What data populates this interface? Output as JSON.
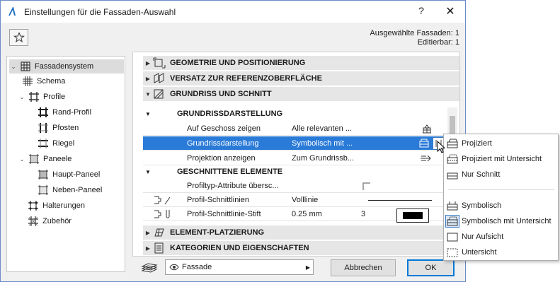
{
  "window": {
    "title": "Einstellungen für die Fassaden-Auswahl",
    "help_label": "?",
    "close_label": "✕"
  },
  "info": {
    "selected": "Ausgewählte Fassaden: 1",
    "editable": "Editierbar: 1"
  },
  "tree": {
    "items": [
      {
        "label": "Fassadensystem",
        "expanded": true,
        "selected": true
      },
      {
        "label": "Schema"
      },
      {
        "label": "Profile",
        "expanded": true
      },
      {
        "label": "Rand-Profil"
      },
      {
        "label": "Pfosten"
      },
      {
        "label": "Riegel"
      },
      {
        "label": "Paneele",
        "expanded": true
      },
      {
        "label": "Haupt-Paneel"
      },
      {
        "label": "Neben-Paneel"
      },
      {
        "label": "Halterungen"
      },
      {
        "label": "Zubehör"
      }
    ]
  },
  "sections": {
    "geometry": "GEOMETRIE UND POSITIONIERUNG",
    "offset": "VERSATZ ZUR REFERENZOBERFLÄCHE",
    "plan": "GRUNDRISS UND SCHNITT",
    "placement": "ELEMENT-PLATZIERUNG",
    "categories": "KATEGORIEN UND EIGENSCHAFTEN"
  },
  "plan": {
    "sub1": "GRUNDRISSDARSTELLUNG",
    "sub2": "GESCHNITTENE ELEMENTE",
    "rows": [
      {
        "label": "Auf Geschoss zeigen",
        "value": "Alle relevanten ..."
      },
      {
        "label": "Grundrissdarstellung",
        "value": "Symbolisch mit ..."
      },
      {
        "label": "Projektion anzeigen",
        "value": "Zum Grundrissb..."
      },
      {
        "label": "Profiltyp-Attribute übersc..."
      },
      {
        "label": "Profil-Schnittlinien",
        "value": "Volllinie"
      },
      {
        "label": "Profil-Schnittlinie-Stift",
        "value": "0.25 mm",
        "num": "3"
      }
    ]
  },
  "footer": {
    "view_select": "Fassade",
    "cancel": "Abbrechen",
    "ok": "OK"
  },
  "popup": {
    "items": [
      {
        "label": "Projiziert"
      },
      {
        "label": "Projiziert mit Untersicht"
      },
      {
        "label": "Nur Schnitt"
      },
      {
        "label": "Symbolisch"
      },
      {
        "label": "Symbolisch mit Untersicht",
        "checked": true
      },
      {
        "label": "Nur Aufsicht"
      },
      {
        "label": "Untersicht"
      }
    ]
  },
  "colors": {
    "selection": "#2a7ad8",
    "accent": "#0078d7"
  }
}
